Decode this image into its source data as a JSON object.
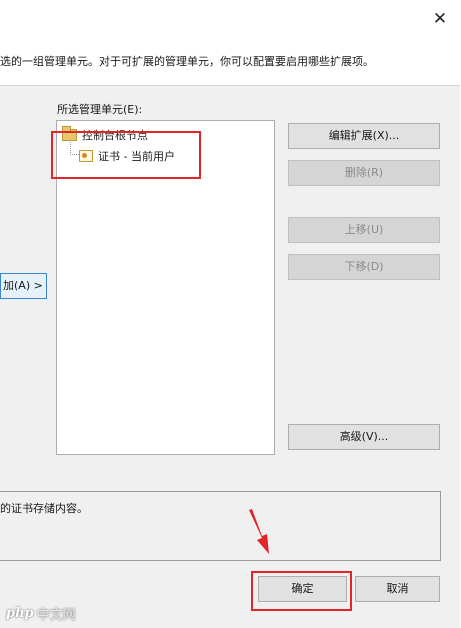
{
  "dialog": {
    "close_glyph": "✕",
    "header_text": "选的一组管理单元。对于可扩展的管理单元，你可以配置要启用哪些扩展项。",
    "selected_label": "所选管理单元(E):",
    "add_button_label": "加(A) >"
  },
  "tree": {
    "items": [
      {
        "label": "控制台根节点",
        "icon": "folder-icon"
      },
      {
        "label": "证书 - 当前用户",
        "icon": "certificate-icon"
      }
    ]
  },
  "buttons": {
    "edit_extensions": "编辑扩展(X)...",
    "remove": "删除(R)",
    "move_up": "上移(U)",
    "move_down": "下移(D)",
    "advanced": "高级(V)...",
    "ok": "确定",
    "cancel": "取消"
  },
  "description": {
    "text": "的证书存储内容。"
  },
  "watermark": {
    "logo": "php",
    "text": "中文网"
  },
  "colors": {
    "highlight_red": "#e0262b",
    "focus_blue": "#3c86d1"
  }
}
